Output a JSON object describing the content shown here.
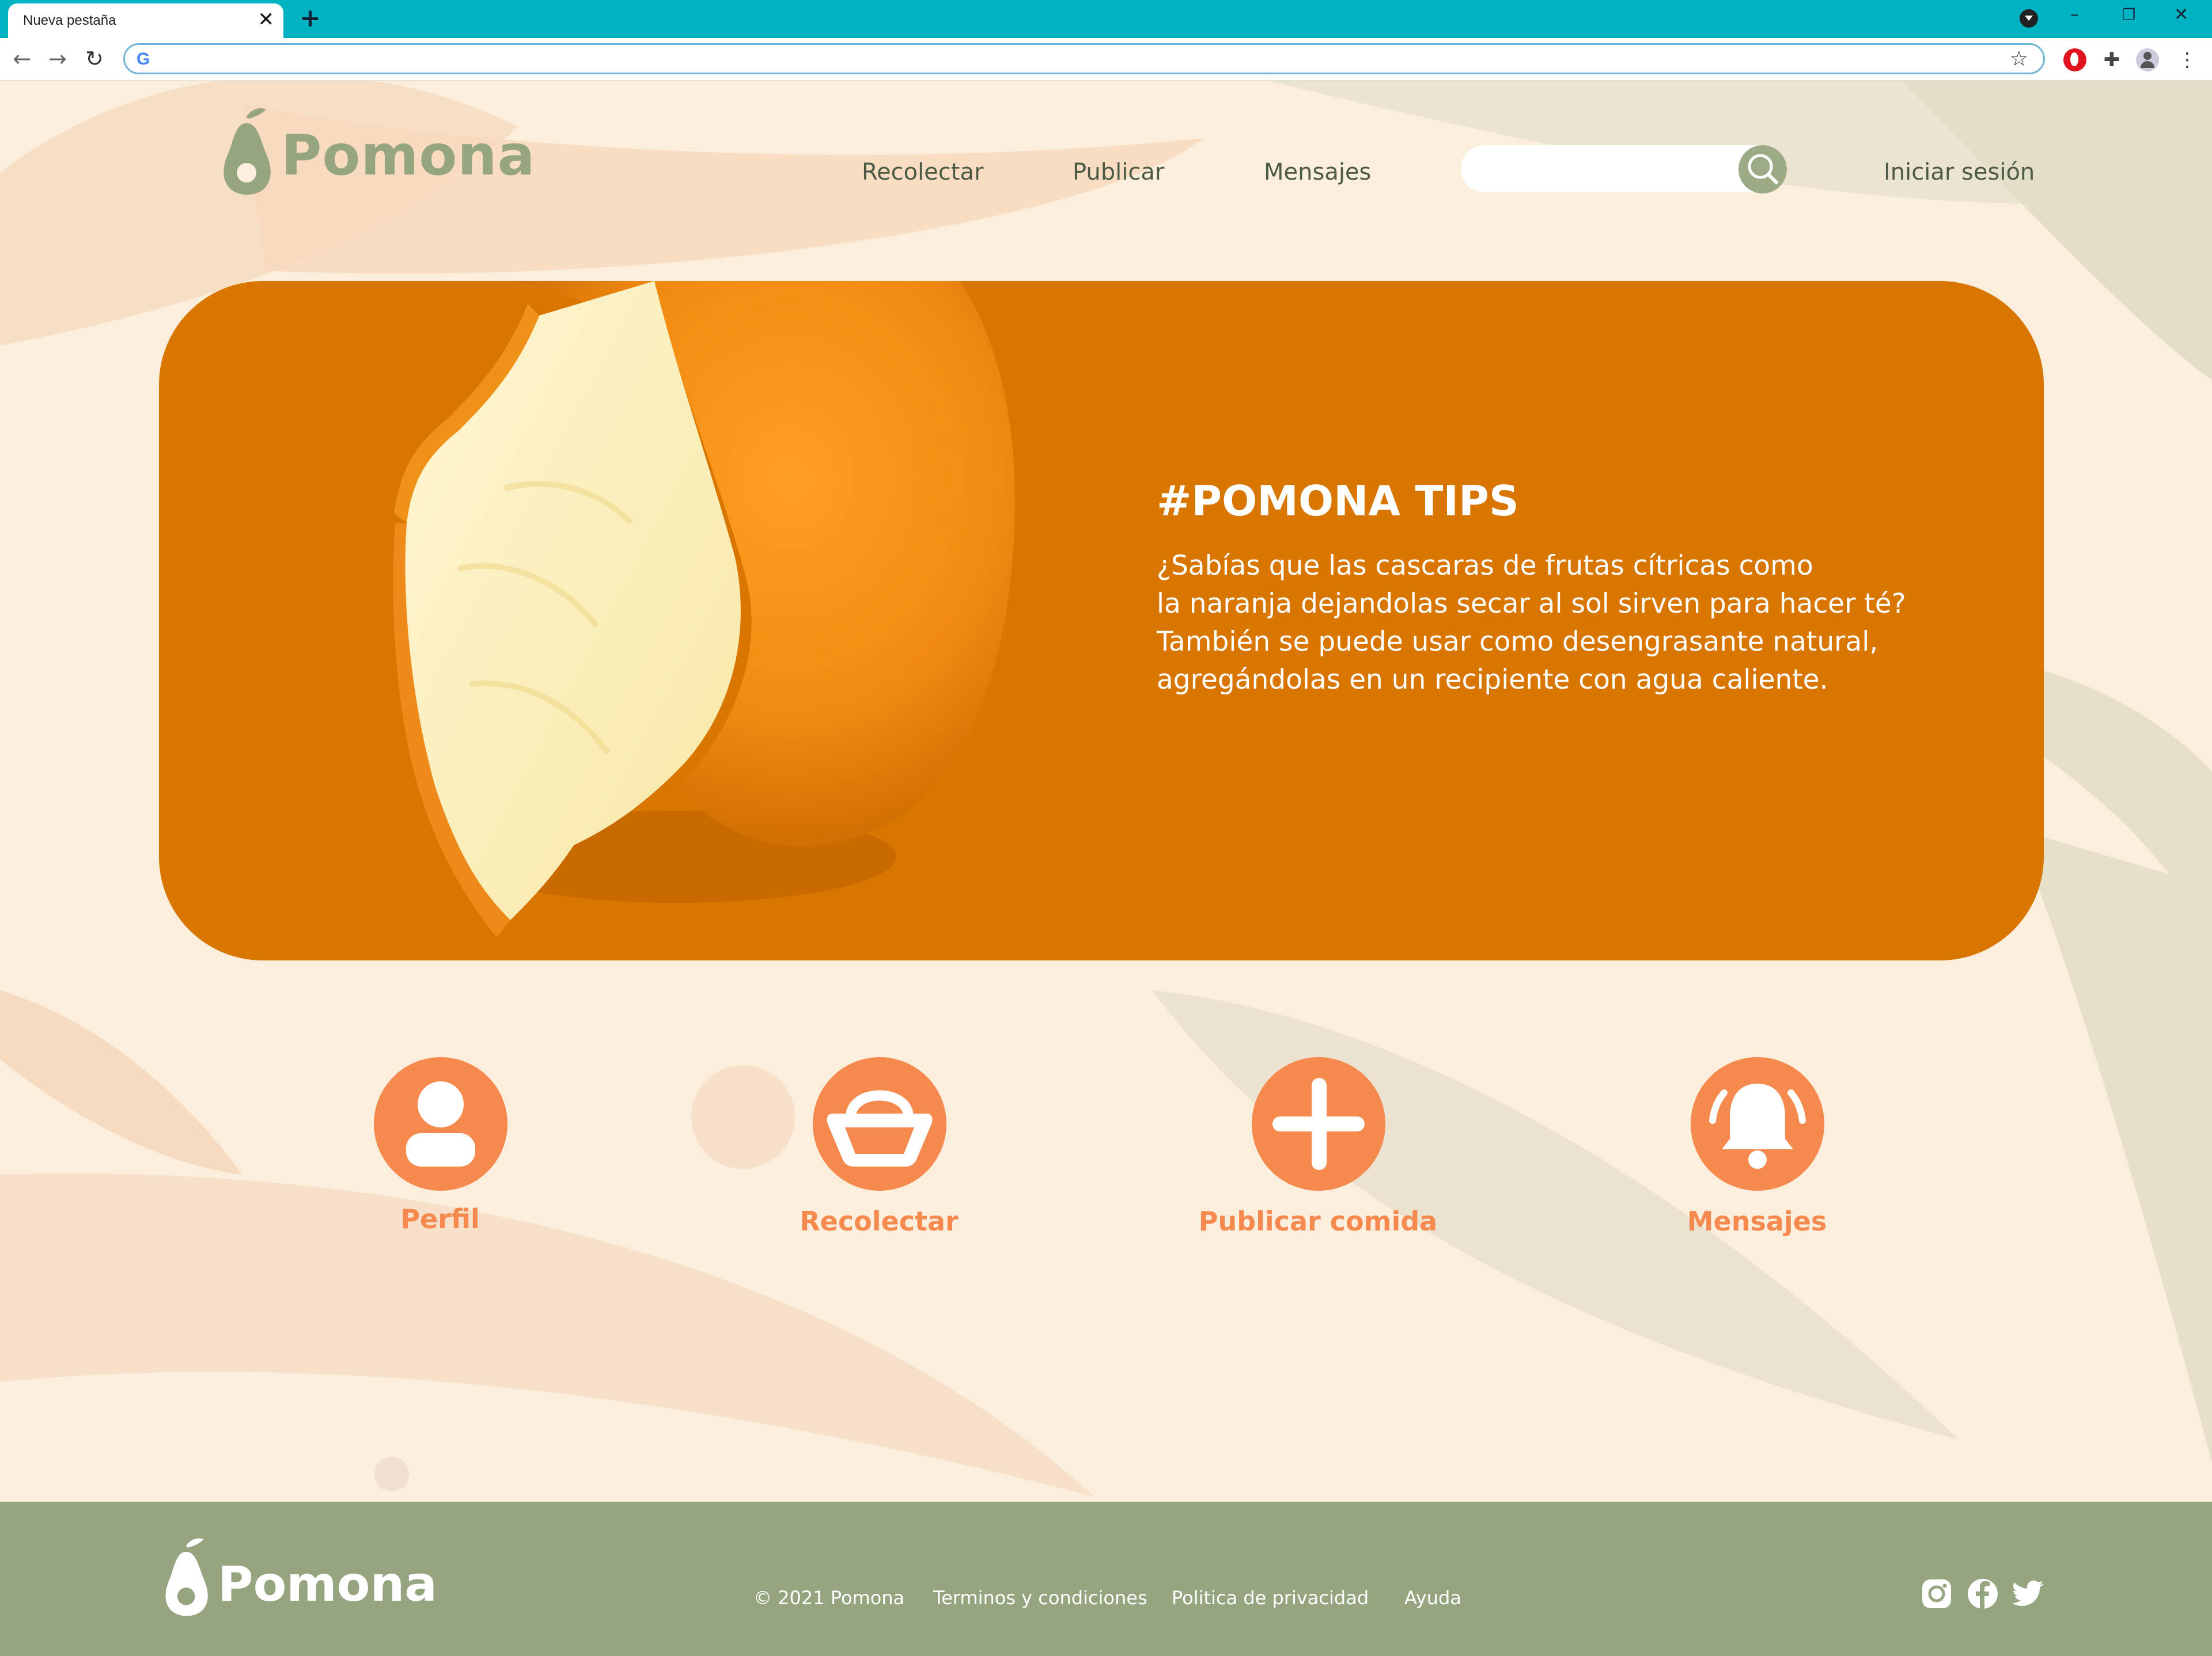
{
  "browser": {
    "tab_title": "Nueva pestaña",
    "tab_close": "✕",
    "new_tab": "+",
    "address": "",
    "minimize": "–",
    "restore": "❐",
    "close": "✕"
  },
  "site": {
    "brand": "Pomona",
    "nav": {
      "recolectar": "Recolectar",
      "publicar": "Publicar",
      "mensajes": "Mensajes",
      "login": "Iniciar sesión"
    },
    "search": {
      "placeholder": ""
    },
    "hero": {
      "title": "#POMONA TIPS",
      "text": "¿Sabías que las cascaras de frutas cítricas como\nla naranja dejandolas secar al sol sirven para hacer té?\nTambién se puede usar como desengrasante natural,\nagregándolas en un recipiente con agua caliente."
    },
    "actions": [
      {
        "label": "Perfil",
        "icon": "user-icon"
      },
      {
        "label": "Recolectar",
        "icon": "basket-icon"
      },
      {
        "label": "Publicar comida",
        "icon": "plus-icon"
      },
      {
        "label": "Mensajes",
        "icon": "bell-icon"
      }
    ],
    "footer": {
      "brand": "Pomona",
      "copyright": "© 2021 Pomona",
      "terms": "Terminos y condiciones",
      "privacy": "Politica de privacidad",
      "help": "Ayuda",
      "social": [
        "instagram-icon",
        "facebook-icon",
        "twitter-icon"
      ]
    }
  },
  "colors": {
    "tabbar": "#00b3c2",
    "page_bg": "#fbeedc",
    "sage": "#94a57f",
    "hero_orange": "#d97600",
    "accent_orange": "#f6894d",
    "nav_text": "#4c5a45"
  }
}
